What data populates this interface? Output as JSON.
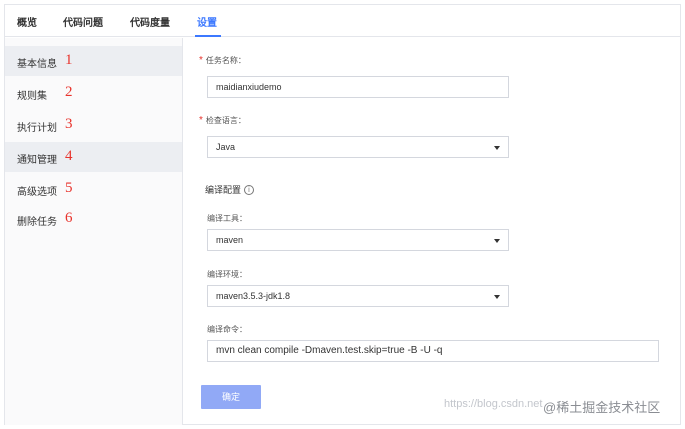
{
  "tabs": [
    {
      "label": "概览",
      "active": false
    },
    {
      "label": "代码问题",
      "active": false
    },
    {
      "label": "代码度量",
      "active": false
    },
    {
      "label": "设置",
      "active": true
    }
  ],
  "sidebar": {
    "items": [
      {
        "label": "基本信息",
        "number": "1",
        "active": true
      },
      {
        "label": "规则集",
        "number": "2",
        "active": false
      },
      {
        "label": "执行计划",
        "number": "3",
        "active": false
      },
      {
        "label": "通知管理",
        "number": "4",
        "active": true
      },
      {
        "label": "高级选项",
        "number": "5",
        "active": false
      },
      {
        "label": "删除任务",
        "number": "6",
        "active": false
      }
    ]
  },
  "form": {
    "task_name_label": "任务名称：",
    "task_name_value": "maidianxiudemo",
    "language_label": "检查语言：",
    "language_value": "Java",
    "compile_config_title": "编译配置",
    "compile_tool_label": "编译工具：",
    "compile_tool_value": "maven",
    "compile_env_label": "编译环境：",
    "compile_env_value": "maven3.5.3-jdk1.8",
    "compile_cmd_label": "编译命令：",
    "compile_cmd_value": "mvn clean compile -Dmaven.test.skip=true -B -U -q",
    "confirm_button": "确定",
    "required_mark": "*",
    "info_glyph": "i"
  },
  "overlay": {
    "url_watermark": "https://blog.csdn.net",
    "brand": "@稀土掘金技术社区"
  },
  "colors": {
    "accent": "#3c78ff",
    "required": "#e8332c",
    "annotation": "#e8332c",
    "button": "#91a9f6"
  }
}
